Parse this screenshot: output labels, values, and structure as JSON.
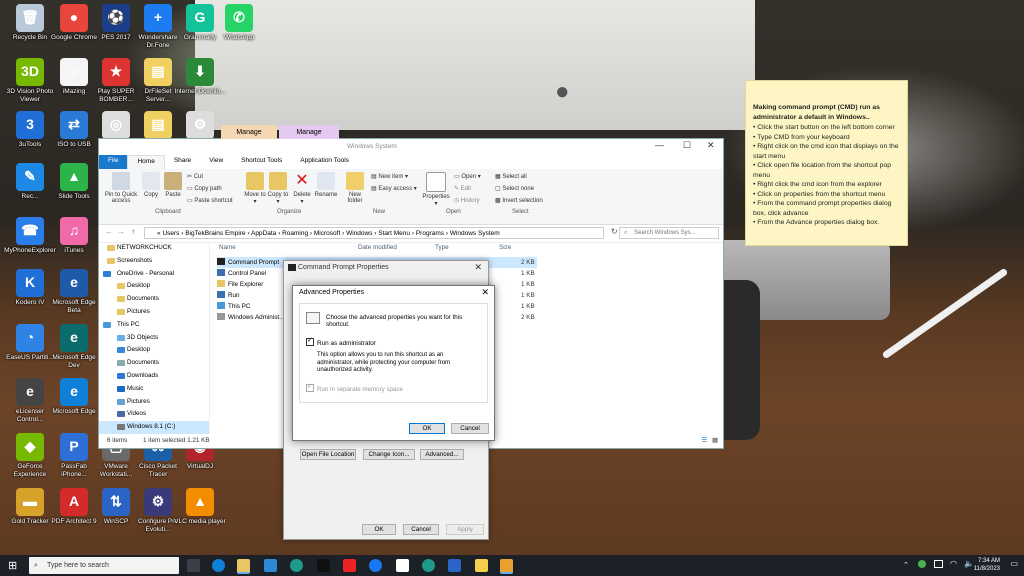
{
  "desktop": {
    "icons": [
      {
        "label": "Recycle Bin",
        "color": "#b9c9d9",
        "glyph": "🗑"
      },
      {
        "label": "Google Chrome",
        "color": "#e8453c",
        "glyph": "●"
      },
      {
        "label": "PES 2017",
        "color": "#1b3e8a",
        "glyph": "⚽"
      },
      {
        "label": "Wondershare Dr.Fone",
        "color": "#1d7cf2",
        "glyph": "+"
      },
      {
        "label": "Grammarly",
        "color": "#15c39a",
        "glyph": "G"
      },
      {
        "label": "WhatsApp",
        "color": "#25d366",
        "glyph": "✆"
      },
      {
        "label": "3D Vision Photo Viewer",
        "color": "#76b900",
        "glyph": "3D"
      },
      {
        "label": "iMazing",
        "color": "#f5f5f5",
        "glyph": "♪"
      },
      {
        "label": "Play SUPER BOMBER...",
        "color": "#d33",
        "glyph": "★"
      },
      {
        "label": "DrFileSet Server...",
        "color": "#f0d060",
        "glyph": "▤"
      },
      {
        "label": "Internet Downlo...",
        "color": "#2a8a3a",
        "glyph": "⬇"
      },
      {
        "label": "3uTools",
        "color": "#1f6fd6",
        "glyph": "3"
      },
      {
        "label": "ISO to USB",
        "color": "#2a7ad6",
        "glyph": "⇄"
      },
      {
        "label": "Pow...",
        "color": "#ddd",
        "glyph": "◎"
      },
      {
        "label": "",
        "color": "#f0d060",
        "glyph": "▤"
      },
      {
        "label": "",
        "color": "#ddd",
        "glyph": "⚙"
      },
      {
        "label": "Rec...",
        "color": "#1e88e5",
        "glyph": "✎"
      },
      {
        "label": "Slide Tools",
        "color": "#2cb34a",
        "glyph": "▲"
      },
      {
        "label": "Pa...",
        "color": "#333",
        "glyph": "▣"
      },
      {
        "label": "MyPhoneExplorer",
        "color": "#2b7de9",
        "glyph": "☎"
      },
      {
        "label": "iTunes",
        "color": "#f06aa8",
        "glyph": "♫"
      },
      {
        "label": "fe...",
        "color": "#333",
        "glyph": "▣"
      },
      {
        "label": "Kodero IV",
        "color": "#1f6fd6",
        "glyph": "K"
      },
      {
        "label": "Microsoft Edge Beta",
        "color": "#1e5aa8",
        "glyph": "e"
      },
      {
        "label": "EaseUS Partiti...",
        "color": "#2f83e4",
        "glyph": "◔"
      },
      {
        "label": "Microsoft Edge Dev",
        "color": "#0c6b6b",
        "glyph": "e"
      },
      {
        "label": "Spe...",
        "color": "#333",
        "glyph": "▣"
      },
      {
        "label": "eLicenser Control...",
        "color": "#444",
        "glyph": "e"
      },
      {
        "label": "Microsoft Edge",
        "color": "#0f7fd8",
        "glyph": "e"
      },
      {
        "label": "Ste... Libr...",
        "color": "#333",
        "glyph": "▣"
      },
      {
        "label": "GeForce Experience",
        "color": "#76b900",
        "glyph": "◆"
      },
      {
        "label": "PassFab iPhone...",
        "color": "#2d6fd6",
        "glyph": "P"
      },
      {
        "label": "VMware Workstati...",
        "color": "#6a6a6a",
        "glyph": "▢"
      },
      {
        "label": "Cisco Packet Tracer",
        "color": "#1b5fa8",
        "glyph": "⌘"
      },
      {
        "label": "VirtualDJ",
        "color": "#b0242a",
        "glyph": "◉"
      },
      {
        "label": "Gold Tracker",
        "color": "#d7a22a",
        "glyph": "▬"
      },
      {
        "label": "PDF Architect 9",
        "color": "#d42a2a",
        "glyph": "A"
      },
      {
        "label": "WinSCP",
        "color": "#2a64c4",
        "glyph": "⇅"
      },
      {
        "label": "Configure Pro Evoluti...",
        "color": "#3a3a7a",
        "glyph": "⚙"
      },
      {
        "label": "VLC media player",
        "color": "#f28c00",
        "glyph": "▲"
      }
    ]
  },
  "sticky": {
    "title": "Making command prompt (CMD) run as administrator a default in Windows..",
    "steps": [
      "• Click the start button on the left bottom corner",
      "• Type CMD from your keyboard",
      "• Right click on the cmd icon that displays on the start menu",
      "• Click open file location from the shortcut pop menu",
      "• Right click the cmd icon from the explorer",
      "• Click on properties from the shortcut menu",
      "• From the command prompt properties dialog box, click advance",
      "• From the Advance properties dialog box."
    ]
  },
  "explorer": {
    "context_tabs": [
      "Manage",
      "Manage"
    ],
    "window_title": "Windows System",
    "tabs": [
      "File",
      "Home",
      "Share",
      "View",
      "Shortcut Tools",
      "Application Tools"
    ],
    "ribbon": {
      "pin": "Pin to Quick access",
      "copy": "Copy",
      "paste": "Paste",
      "cut": "Cut",
      "copy_path": "Copy path",
      "paste_shortcut": "Paste shortcut",
      "move_to": "Move to ▾",
      "copy_to": "Copy to ▾",
      "delete": "Delete ▾",
      "rename": "Rename",
      "new_folder": "New folder",
      "new_item": "New item ▾",
      "easy_access": "Easy access ▾",
      "properties": "Properties ▾",
      "open": "Open ▾",
      "edit": "Edit",
      "history": "History",
      "select_all": "Select all",
      "select_none": "Select none",
      "invert_selection": "Invert selection",
      "groups": [
        "Clipboard",
        "Organize",
        "New",
        "Open",
        "Select"
      ]
    },
    "address": [
      "«",
      "Users",
      "›",
      "BigTekBrains Empire",
      "›",
      "AppData",
      "›",
      "Roaming",
      "›",
      "Microsoft",
      "›",
      "Windows",
      "›",
      "Start Menu",
      "›",
      "Programs",
      "›",
      "Windows System"
    ],
    "search_placeholder": "Search Windows Sys...",
    "nav": [
      "NETWORKCHUCK",
      "Screenshots",
      "OneDrive - Personal",
      "Desktop",
      "Documents",
      "Pictures",
      "This PC",
      "3D Objects",
      "Desktop",
      "Documents",
      "Downloads",
      "Music",
      "Pictures",
      "Videos",
      "Windows 8.1 (C:)"
    ],
    "columns": [
      "Name",
      "Date modified",
      "Type",
      "Size"
    ],
    "files": [
      {
        "name": "Command Prompt",
        "size": "2 KB"
      },
      {
        "name": "Control Panel",
        "size": "1 KB"
      },
      {
        "name": "File Explorer",
        "size": "1 KB"
      },
      {
        "name": "Run",
        "size": "1 KB"
      },
      {
        "name": "This PC",
        "size": "1 KB"
      },
      {
        "name": "Windows Administ...",
        "size": "2 KB"
      }
    ],
    "status_items": "6 items",
    "status_selected": "1 item selected  1.21 KB"
  },
  "props": {
    "title": "Command Prompt Properties",
    "open_file_location": "Open File Location",
    "change_icon": "Change Icon...",
    "advanced": "Advanced...",
    "ok": "OK",
    "cancel": "Cancel",
    "apply": "Apply"
  },
  "advanced": {
    "title": "Advanced Properties",
    "prompt": "Choose the advanced properties you want for this shortcut.",
    "run_as_admin": "Run as administrator",
    "run_as_admin_checked": true,
    "description": "This option allows you to run this shortcut as an administrator, while protecting your computer from unauthorized activity.",
    "separate_memory": "Run in separate memory space",
    "ok": "OK",
    "cancel": "Cancel"
  },
  "taskbar": {
    "search_placeholder": "Type here to search",
    "time": "7:34 AM",
    "date": "11/8/2023"
  }
}
